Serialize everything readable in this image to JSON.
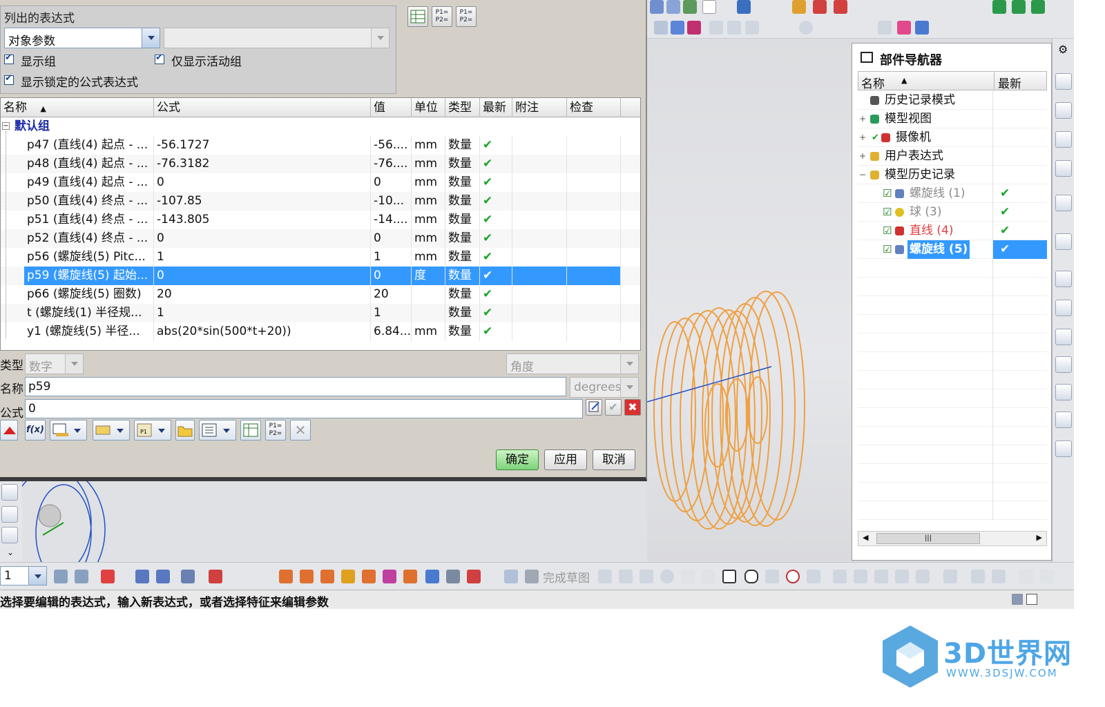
{
  "dialog": {
    "group_title": "列出的表达式",
    "list_mode": "对象参数",
    "show_groups": "显示组",
    "show_active_only": "仅显示活动组",
    "show_locked": "显示锁定的公式表达式"
  },
  "grid": {
    "columns": [
      "名称",
      "公式",
      "值",
      "单位",
      "类型",
      "最新",
      "附注",
      "检查"
    ],
    "group_name": "默认组",
    "rows": [
      {
        "name": "p47 (直线(4) 起点 - ...",
        "formula": "-56.1727",
        "value": "-56....",
        "unit": "mm",
        "type": "数量",
        "latest": "✔"
      },
      {
        "name": "p48 (直线(4) 起点 - ...",
        "formula": "-76.3182",
        "value": "-76....",
        "unit": "mm",
        "type": "数量",
        "latest": "✔"
      },
      {
        "name": "p49 (直线(4) 起点 - ...",
        "formula": "0",
        "value": "0",
        "unit": "mm",
        "type": "数量",
        "latest": "✔"
      },
      {
        "name": "p50 (直线(4) 终点 - ...",
        "formula": "-107.85",
        "value": "-10...",
        "unit": "mm",
        "type": "数量",
        "latest": "✔"
      },
      {
        "name": "p51 (直线(4) 终点 - ...",
        "formula": "-143.805",
        "value": "-14....",
        "unit": "mm",
        "type": "数量",
        "latest": "✔"
      },
      {
        "name": "p52 (直线(4) 终点 - ...",
        "formula": "0",
        "value": "0",
        "unit": "mm",
        "type": "数量",
        "latest": "✔"
      },
      {
        "name": "p56 (螺旋线(5) Pitc...",
        "formula": "1",
        "value": "1",
        "unit": "mm",
        "type": "数量",
        "latest": "✔"
      },
      {
        "name": "p59 (螺旋线(5) 起始...",
        "formula": "0",
        "value": "0",
        "unit": "度",
        "type": "数量",
        "latest": "✔"
      },
      {
        "name": "p66 (螺旋线(5) 圈数)",
        "formula": "20",
        "value": "20",
        "unit": "",
        "type": "数量",
        "latest": "✔"
      },
      {
        "name": "t (螺旋线(1) 半径规...",
        "formula": "1",
        "value": "1",
        "unit": "",
        "type": "数量",
        "latest": "✔"
      },
      {
        "name": "y1 (螺旋线(5) 半径...",
        "formula": "abs(20*sin(500*t+20))",
        "value": "6.84...",
        "unit": "mm",
        "type": "数量",
        "latest": "✔"
      }
    ]
  },
  "editor": {
    "type_label": "类型",
    "type_value": "数字",
    "dimension_value": "角度",
    "name_label": "名称",
    "name_value": "p59",
    "unit_value": "degrees",
    "formula_label": "公式",
    "formula_value": "0",
    "fx_label": "f(x)"
  },
  "buttons": {
    "ok": "确定",
    "apply": "应用",
    "cancel": "取消"
  },
  "navigator": {
    "title": "部件导航器",
    "col_name": "名称",
    "col_latest": "最新",
    "items": [
      {
        "label": "历史记录模式",
        "latest": ""
      },
      {
        "label": "模型视图",
        "latest": ""
      },
      {
        "label": "摄像机",
        "latest": ""
      },
      {
        "label": "用户表达式",
        "latest": ""
      },
      {
        "label": "模型历史记录",
        "latest": ""
      },
      {
        "label": "螺旋线 (1)",
        "latest": "✔"
      },
      {
        "label": "球 (3)",
        "latest": "✔"
      },
      {
        "label": "直线 (4)",
        "latest": "✔"
      },
      {
        "label": "螺旋线 (5)",
        "latest": "✔"
      }
    ]
  },
  "bottom_toolbar": {
    "layer_value": "1",
    "finish_sketch": "完成草图"
  },
  "status": {
    "text": "选择要编辑的表达式，输入新表达式，或者选择特征来编辑参数"
  },
  "watermark": {
    "brand": "3D世界网",
    "url": "WWW.3DSJW.COM"
  },
  "colors": {
    "selection": "#3399ff",
    "helix": "#f0a040",
    "ok_button": "#7ed27a",
    "group_text": "#1a2aa8"
  }
}
